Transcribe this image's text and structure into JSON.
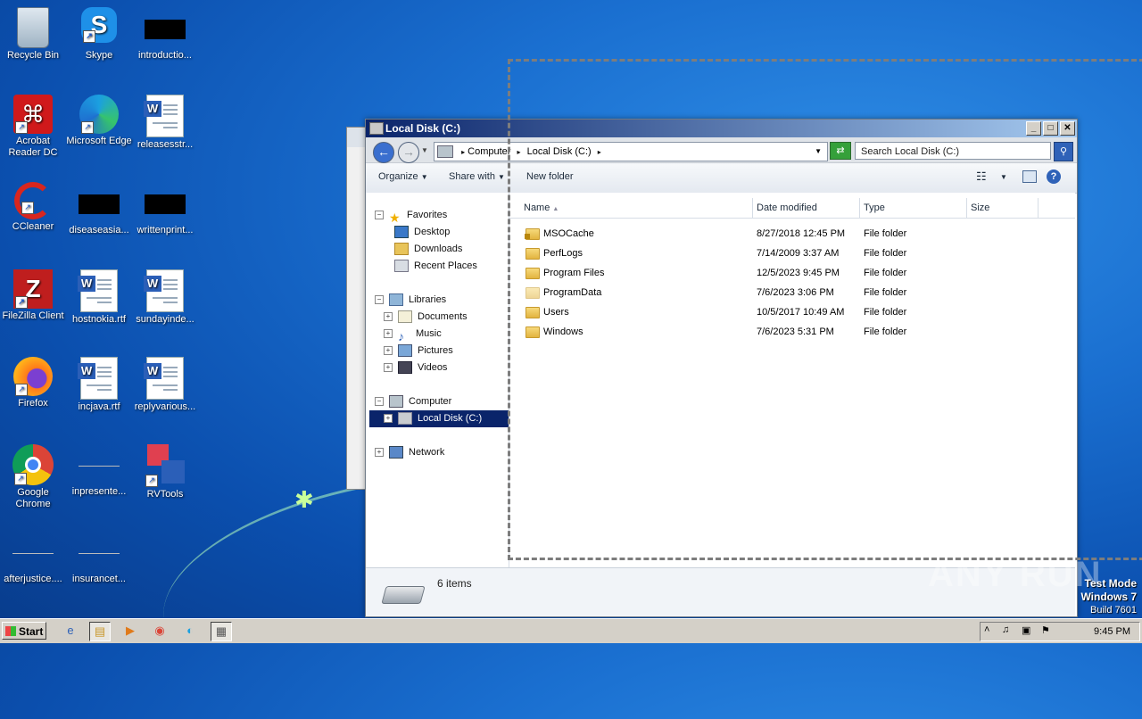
{
  "desktop": {
    "icons": [
      {
        "label": "Recycle Bin"
      },
      {
        "label": "Skype"
      },
      {
        "label": "introductio..."
      },
      {
        "label": "Acrobat Reader DC"
      },
      {
        "label": "Microsoft Edge"
      },
      {
        "label": "releasesstr..."
      },
      {
        "label": "CCleaner"
      },
      {
        "label": "diseaseasia..."
      },
      {
        "label": "writtenprint..."
      },
      {
        "label": "FileZilla Client"
      },
      {
        "label": "hostnokia.rtf"
      },
      {
        "label": "sundayinde..."
      },
      {
        "label": "Firefox"
      },
      {
        "label": "incjava.rtf"
      },
      {
        "label": "replyvarious..."
      },
      {
        "label": "Google Chrome"
      },
      {
        "label": "inpresente..."
      },
      {
        "label": "RVTools"
      },
      {
        "label": "afterjustice...."
      },
      {
        "label": "insurancet..."
      }
    ]
  },
  "window": {
    "title": "Local Disk (C:)",
    "address": {
      "segment1": "Computer",
      "segment2": "Local Disk (C:)"
    },
    "search_placeholder": "Search Local Disk (C:)",
    "toolbar": {
      "organize": "Organize",
      "share_with": "Share with",
      "new_folder": "New folder"
    },
    "nav": {
      "favorites": "Favorites",
      "desktop": "Desktop",
      "downloads": "Downloads",
      "recent_places": "Recent Places",
      "libraries": "Libraries",
      "documents": "Documents",
      "music": "Music",
      "pictures": "Pictures",
      "videos": "Videos",
      "computer": "Computer",
      "local_disk": "Local Disk (C:)",
      "network": "Network"
    },
    "columns": {
      "name": "Name",
      "date": "Date modified",
      "type": "Type",
      "size": "Size"
    },
    "files": [
      {
        "name": "MSOCache",
        "date": "8/27/2018 12:45 PM",
        "type": "File folder"
      },
      {
        "name": "PerfLogs",
        "date": "7/14/2009 3:37 AM",
        "type": "File folder"
      },
      {
        "name": "Program Files",
        "date": "12/5/2023 9:45 PM",
        "type": "File folder"
      },
      {
        "name": "ProgramData",
        "date": "7/6/2023 3:06 PM",
        "type": "File folder"
      },
      {
        "name": "Users",
        "date": "10/5/2017 10:49 AM",
        "type": "File folder"
      },
      {
        "name": "Windows",
        "date": "7/6/2023 5:31 PM",
        "type": "File folder"
      }
    ],
    "status": "6 items"
  },
  "taskbar": {
    "start": "Start",
    "clock": "9:45 PM"
  },
  "test_mode": {
    "line1": "Test Mode",
    "line2": "Windows 7",
    "line3": "Build 7601"
  },
  "watermark": "ANY RUN"
}
